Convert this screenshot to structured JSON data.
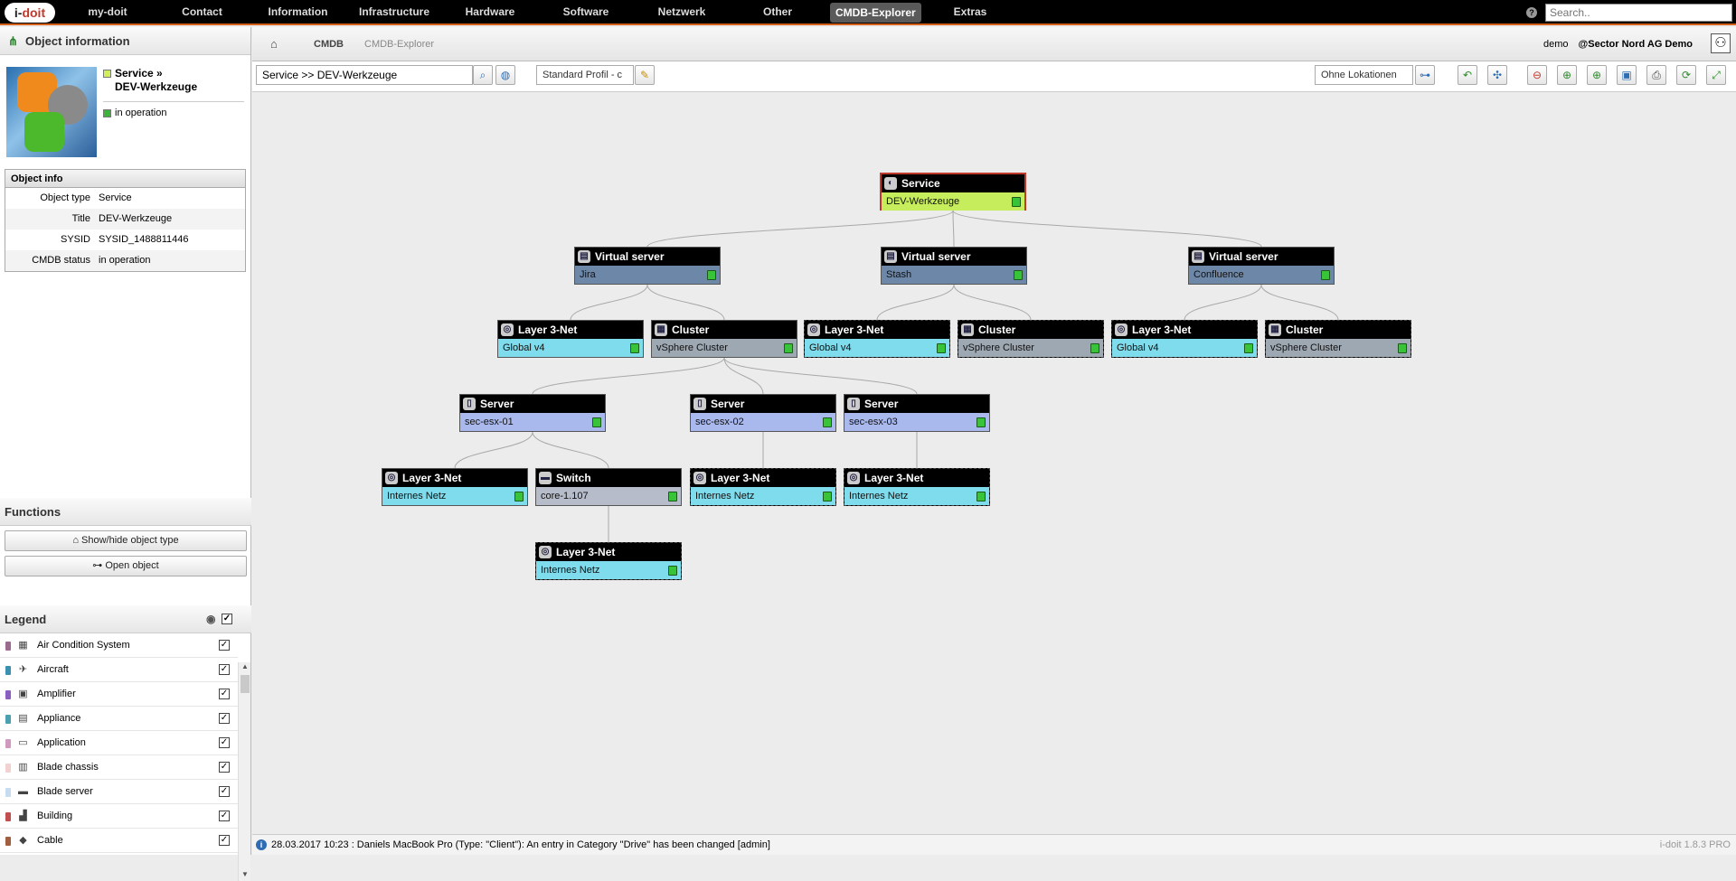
{
  "app": {
    "logo_text_a": "i-",
    "logo_text_b": "doit"
  },
  "topnav": {
    "items": [
      "my-doit",
      "Contact",
      "Information",
      "Infrastructure",
      "Hardware",
      "Software",
      "Netzwerk",
      "Other",
      "CMDB-Explorer",
      "Extras"
    ],
    "active": "CMDB-Explorer",
    "help_icon": "?",
    "search_placeholder": "Search.."
  },
  "left": {
    "header": "Object information",
    "object_title_line1": "Service »",
    "object_title_line2": "DEV-Werkzeuge",
    "object_status": "in operation",
    "info": {
      "header": "Object info",
      "rows": [
        {
          "key": "Object type",
          "value": "Service"
        },
        {
          "key": "Title",
          "value": "DEV-Werkzeuge"
        },
        {
          "key": "SYSID",
          "value": "SYSID_1488811446"
        },
        {
          "key": "CMDB status",
          "value": "in operation"
        }
      ]
    },
    "functions": {
      "header": "Functions",
      "show_hide": "Show/hide object type",
      "open_object": "Open object"
    },
    "legend": {
      "header": "Legend",
      "items": [
        {
          "label": "Air Condition System",
          "color": "#9b6b8f",
          "icon": "▦"
        },
        {
          "label": "Aircraft",
          "color": "#3b8fb0",
          "icon": "✈"
        },
        {
          "label": "Amplifier",
          "color": "#8b5fc0",
          "icon": "▣"
        },
        {
          "label": "Appliance",
          "color": "#4aa0b0",
          "icon": "▤"
        },
        {
          "label": "Application",
          "color": "#d09ac0",
          "icon": "▭"
        },
        {
          "label": "Blade chassis",
          "color": "#f2d2d0",
          "icon": "▥"
        },
        {
          "label": "Blade server",
          "color": "#c8dcf0",
          "icon": "▬"
        },
        {
          "label": "Building",
          "color": "#c05050",
          "icon": "▟"
        },
        {
          "label": "Cable",
          "color": "#a06040",
          "icon": "◆"
        }
      ]
    }
  },
  "breadcrumb": {
    "items": [
      "CMDB",
      "CMDB-Explorer"
    ],
    "user": "demo",
    "tenant": "@Sector Nord AG Demo"
  },
  "toolbar": {
    "object_search": "Service >> DEV-Werkzeuge",
    "profile": "Standard Profil - c",
    "location": "Ohne Lokationen"
  },
  "graph": {
    "nodes": [
      {
        "id": "n0",
        "type": "Service",
        "title": "DEV-Werkzeuge",
        "color": "#c6ee5c",
        "style": "root",
        "icon": "◐"
      },
      {
        "id": "n1",
        "type": "Virtual server",
        "title": "Jira",
        "color": "#6d87a8",
        "style": "solid",
        "icon": "▤"
      },
      {
        "id": "n2",
        "type": "Virtual server",
        "title": "Stash",
        "color": "#6d87a8",
        "style": "solid",
        "icon": "▤"
      },
      {
        "id": "n3",
        "type": "Virtual server",
        "title": "Confluence",
        "color": "#6d87a8",
        "style": "solid",
        "icon": "▤"
      },
      {
        "id": "n4",
        "type": "Layer 3-Net",
        "title": "Global v4",
        "color": "#7fdcec",
        "style": "solid",
        "icon": "◎"
      },
      {
        "id": "n5",
        "type": "Cluster",
        "title": "vSphere Cluster",
        "color": "#9ea8b3",
        "style": "solid",
        "icon": "▦"
      },
      {
        "id": "n6",
        "type": "Layer 3-Net",
        "title": "Global v4",
        "color": "#7fdcec",
        "style": "dashed",
        "icon": "◎"
      },
      {
        "id": "n7",
        "type": "Cluster",
        "title": "vSphere Cluster",
        "color": "#9ea8b3",
        "style": "dashed",
        "icon": "▦"
      },
      {
        "id": "n8",
        "type": "Layer 3-Net",
        "title": "Global v4",
        "color": "#7fdcec",
        "style": "dashed",
        "icon": "◎"
      },
      {
        "id": "n9",
        "type": "Cluster",
        "title": "vSphere Cluster",
        "color": "#9ea8b3",
        "style": "dashed",
        "icon": "▦"
      },
      {
        "id": "n10",
        "type": "Server",
        "title": "sec-esx-01",
        "color": "#a9b9ee",
        "style": "solid",
        "icon": "▯"
      },
      {
        "id": "n11",
        "type": "Server",
        "title": "sec-esx-02",
        "color": "#a9b9ee",
        "style": "solid",
        "icon": "▯"
      },
      {
        "id": "n12",
        "type": "Server",
        "title": "sec-esx-03",
        "color": "#a9b9ee",
        "style": "solid",
        "icon": "▯"
      },
      {
        "id": "n13",
        "type": "Layer 3-Net",
        "title": "Internes Netz",
        "color": "#7fdcec",
        "style": "solid",
        "icon": "◎"
      },
      {
        "id": "n14",
        "type": "Switch",
        "title": "core-1.107",
        "color": "#b7bccb",
        "style": "solid",
        "icon": "▬"
      },
      {
        "id": "n15",
        "type": "Layer 3-Net",
        "title": "Internes Netz",
        "color": "#7fdcec",
        "style": "dashed",
        "icon": "◎"
      },
      {
        "id": "n16",
        "type": "Layer 3-Net",
        "title": "Internes Netz",
        "color": "#7fdcec",
        "style": "dashed",
        "icon": "◎"
      },
      {
        "id": "n17",
        "type": "Layer 3-Net",
        "title": "Internes Netz",
        "color": "#7fdcec",
        "style": "dashed",
        "icon": "◎"
      }
    ],
    "edges": [
      [
        "n0",
        "n1"
      ],
      [
        "n0",
        "n2"
      ],
      [
        "n0",
        "n3"
      ],
      [
        "n1",
        "n4"
      ],
      [
        "n1",
        "n5"
      ],
      [
        "n2",
        "n6"
      ],
      [
        "n2",
        "n7"
      ],
      [
        "n3",
        "n8"
      ],
      [
        "n3",
        "n9"
      ],
      [
        "n5",
        "n10"
      ],
      [
        "n5",
        "n11"
      ],
      [
        "n5",
        "n12"
      ],
      [
        "n10",
        "n13"
      ],
      [
        "n10",
        "n14"
      ],
      [
        "n11",
        "n15"
      ],
      [
        "n12",
        "n16"
      ],
      [
        "n14",
        "n17"
      ]
    ]
  },
  "status": {
    "message": "28.03.2017 10:23 : Daniels MacBook Pro (Type: \"Client\"): An entry in Category \"Drive\" has been changed [admin]",
    "version": "i-doit 1.8.3 PRO"
  }
}
